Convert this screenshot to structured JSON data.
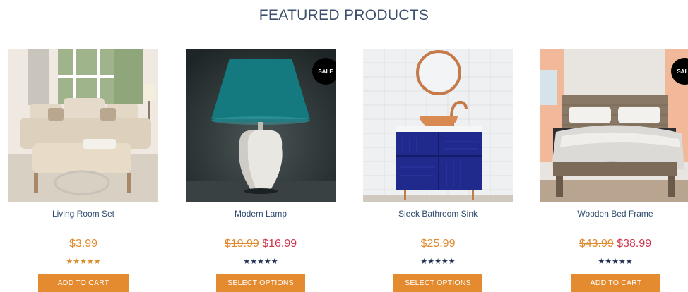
{
  "section": {
    "title": "FEATURED PRODUCTS"
  },
  "products": [
    {
      "name": "Living Room Set",
      "price": "$3.99",
      "stars": "★★★★★",
      "button": "ADD TO CART"
    },
    {
      "name": "Modern Lamp",
      "badge": "SALE",
      "old_price": "$19.99",
      "price": "$16.99",
      "stars": "★★★★★",
      "button": "SELECT OPTIONS"
    },
    {
      "name": "Sleek Bathroom Sink",
      "price": "$25.99",
      "stars": "★★★★★",
      "button": "SELECT OPTIONS"
    },
    {
      "name": "Wooden Bed Frame",
      "badge": "SALE",
      "old_price": "$43.99",
      "price": "$38.99",
      "stars": "★★★★★",
      "button": "ADD TO CART"
    }
  ],
  "colors": {
    "title": "#3d4f6b",
    "button": "#e48a2f",
    "price": "#e08a2e",
    "sale_price": "#d0374f",
    "stars_gold": "#d98a27",
    "stars_navy": "#1f2d52"
  }
}
